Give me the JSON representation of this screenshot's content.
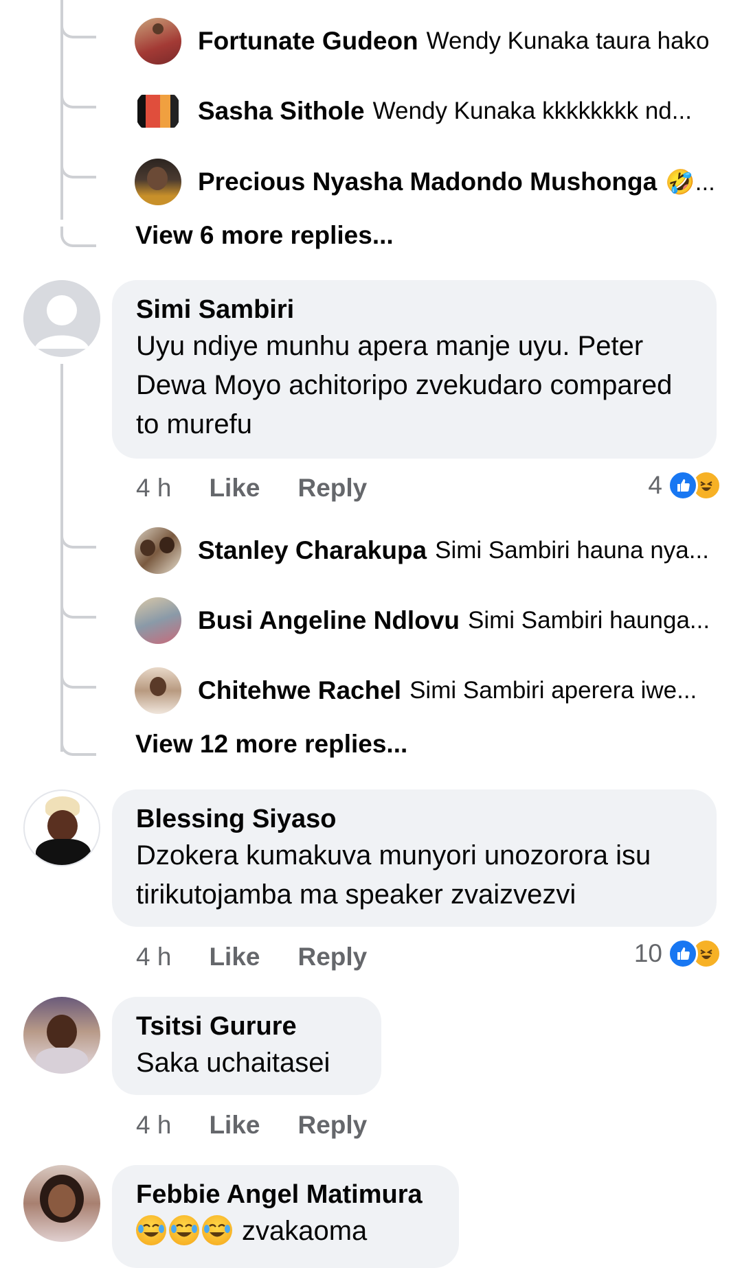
{
  "thread1": {
    "replies": [
      {
        "name": "Fortunate Gudeon",
        "text": "Wendy Kunaka taura hako"
      },
      {
        "name": "Sasha Sithole",
        "text": "Wendy Kunaka  kkkkkkkk nd..."
      },
      {
        "name": "Precious Nyasha Madondo Mushonga",
        "text": "🤣..."
      }
    ],
    "more": "View 6 more replies..."
  },
  "comments": [
    {
      "name": "Simi Sambiri",
      "text": "Uyu ndiye munhu apera manje uyu. Peter Dewa Moyo achitoripo zvekudaro compared to murefu",
      "time": "4 h",
      "like": "Like",
      "reply": "Reply",
      "reaction_count": "4",
      "replies": [
        {
          "name": "Stanley Charakupa",
          "text": "Simi Sambiri hauna nya..."
        },
        {
          "name": "Busi Angeline Ndlovu",
          "text": "Simi Sambiri haunga..."
        },
        {
          "name": "Chitehwe Rachel",
          "text": "Simi Sambiri aperera iwe..."
        }
      ],
      "more": "View 12 more replies..."
    },
    {
      "name": "Blessing Siyaso",
      "text": "Dzokera kumakuva munyori unozorora isu tirikutojamba ma speaker zvaizvezvi",
      "time": "4 h",
      "like": "Like",
      "reply": "Reply",
      "reaction_count": "10"
    },
    {
      "name": "Tsitsi Gurure",
      "text": "Saka uchaitasei",
      "time": "4 h",
      "like": "Like",
      "reply": "Reply"
    },
    {
      "name": "Febbie Angel Matimura",
      "text": "zvakaoma"
    }
  ],
  "colors": {
    "bubble": "#f0f2f5",
    "meta": "#65676b",
    "thread_line": "#ced0d4",
    "like_blue": "#1877f2",
    "haha_yellow": "#f7b125"
  },
  "icons": [
    "like-reaction-icon",
    "haha-reaction-icon",
    "default-avatar-icon"
  ]
}
